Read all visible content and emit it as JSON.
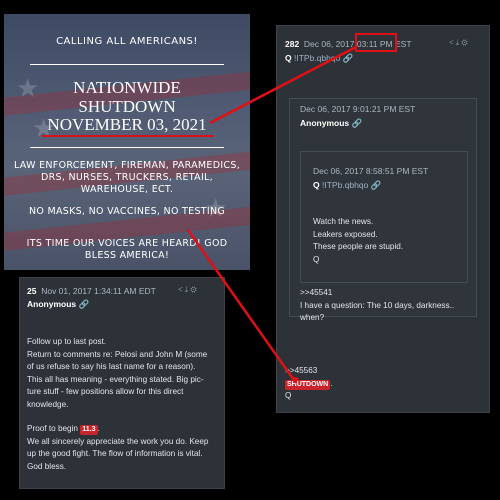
{
  "flyer": {
    "heading": "CALLING ALL AMERICANS!",
    "line1": "NATIONWIDE",
    "line2": "SHUTDOWN",
    "line3": "NOVEMBER 03, 2021",
    "workers": "LAW ENFORCEMENT, FIREMAN, PARAMEDICS, DRS, NURSES, TRUCKERS, RETAIL, WAREHOUSE, ECT.",
    "nomasks": "NO MASKS, NO VACCINES, NO TESTING",
    "voices": "ITS TIME OUR VOICES ARE HEARD! GOD BLESS AMERICA!"
  },
  "post_282": {
    "number": "282",
    "date": "Dec 06, 2017",
    "time": "03:11",
    "ampm": "PM EST",
    "author": "Q",
    "trip": "!ITPb.qbhqo",
    "quote1": {
      "date": "Dec 06, 2017 9:01:21 PM EST",
      "author": "Anonymous",
      "quote2": {
        "date": "Dec 06, 2017 8:58:51 PM EST",
        "author": "Q",
        "trip": "!ITPb.qbhqo",
        "lines": [
          "Watch the news.",
          "Leakers exposed.",
          "These people are stupid.",
          "Q"
        ]
      },
      "ref": ">>45541",
      "text1": "I have a question: The 10 days, darkness..",
      "text2": "when?"
    },
    "ref2": ">>45563",
    "shutdown_tag": "SHUTDOWN",
    "shutdown_suffix": ".",
    "sign": "Q"
  },
  "post_25": {
    "number": "25",
    "date": "Nov 01, 2017 1:34:11 AM EDT",
    "author": "Anonymous",
    "lines": [
      "Follow up to last post.",
      "Return to comments re: Pelosi and John M (some",
      "of us refuse to say his last name for a reason).",
      "This all has meaning - everything stated. Big pic-",
      "ture stuff - few positions allow for this direct",
      "knowledge."
    ],
    "proof_prefix": "Proof to begin",
    "proof_tag": "11.3",
    "proof_suffix": ".",
    "closing": [
      "We all sincerely appreciate the work you do. Keep",
      "up the good fight. The flow of information is vital.",
      "God bless."
    ]
  },
  "icons": {
    "link": "link-icon",
    "share": "share-icon",
    "download": "download-icon",
    "settings": "gear-icon"
  },
  "colors": {
    "highlight_red": "#e01016",
    "card_bg": "#2d3238",
    "link_blue": "#3a8fd8"
  }
}
